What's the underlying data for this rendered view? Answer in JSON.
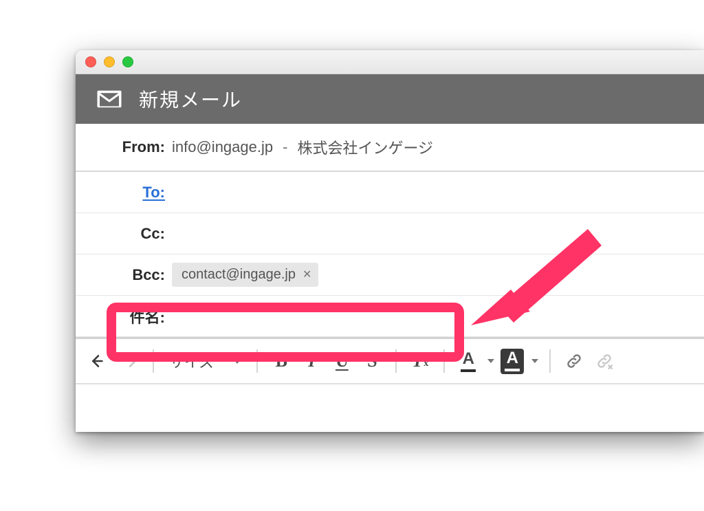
{
  "window": {
    "title": "新規メール"
  },
  "fields": {
    "from_label": "From:",
    "from_email": "info@ingage.jp",
    "from_name": "株式会社インゲージ",
    "to_label": "To:",
    "cc_label": "Cc:",
    "bcc_label": "Bcc:",
    "bcc_chip": "contact@ingage.jp",
    "subject_label": "件名:"
  },
  "toolbar": {
    "size_label": "サイズ",
    "bold": "B",
    "italic": "I",
    "underline": "U",
    "strike": "S",
    "clear_T": "T",
    "clear_x": "x",
    "fontcolor": "A",
    "highlight": "A"
  },
  "annotation": {
    "box_color": "#ff3366"
  }
}
